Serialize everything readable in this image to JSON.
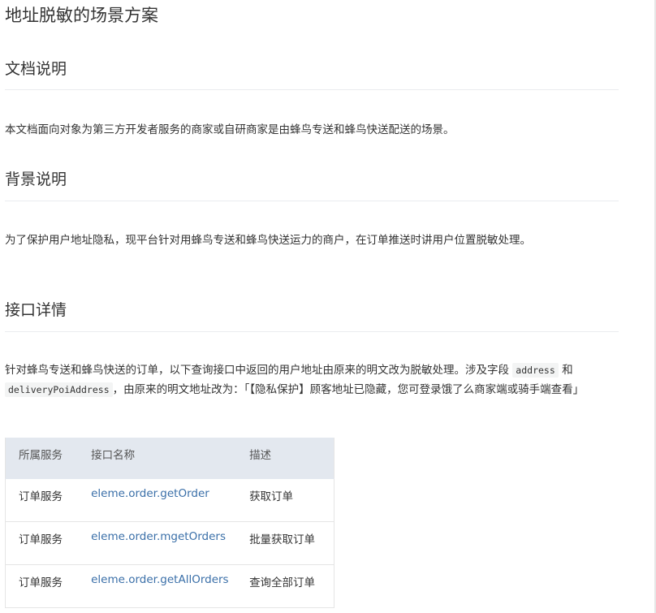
{
  "page": {
    "title": "地址脱敏的场景方案"
  },
  "sections": [
    {
      "heading": "文档说明",
      "body": "本文档面向对象为第三方开发者服务的商家或自研商家是由蜂鸟专送和蜂鸟快送配送的场景。"
    },
    {
      "heading": "背景说明",
      "body": "为了保护用户地址隐私，现平台针对用蜂鸟专送和蜂鸟快送运力的商户，在订单推送时讲用户位置脱敏处理。"
    },
    {
      "heading": "接口详情",
      "body_part1": "针对蜂鸟专送和蜂鸟快送的订单，以下查询接口中返回的用户地址由原来的明文改为脱敏处理。涉及字段",
      "code1": "address",
      "connector": "和",
      "code2": "deliveryPoiAddress",
      "body_part2": "，由原来的明文地址改为：「【隐私保护】顾客地址已隐藏，您可登录饿了么商家端或骑手端查看」"
    }
  ],
  "table": {
    "headers": [
      "所属服务",
      "接口名称",
      "描述"
    ],
    "rows": [
      {
        "service": "订单服务",
        "api": "eleme.order.getOrder",
        "desc": "获取订单"
      },
      {
        "service": "订单服务",
        "api": "eleme.order.mgetOrders",
        "desc": "批量获取订单"
      },
      {
        "service": "订单服务",
        "api": "eleme.order.getAllOrders",
        "desc": "查询全部订单"
      }
    ]
  },
  "colors": {
    "link": "#3a6fa8",
    "table_header_bg": "#e3e8ef",
    "divider": "#eaecef",
    "code_bg": "#f3f4f4"
  }
}
